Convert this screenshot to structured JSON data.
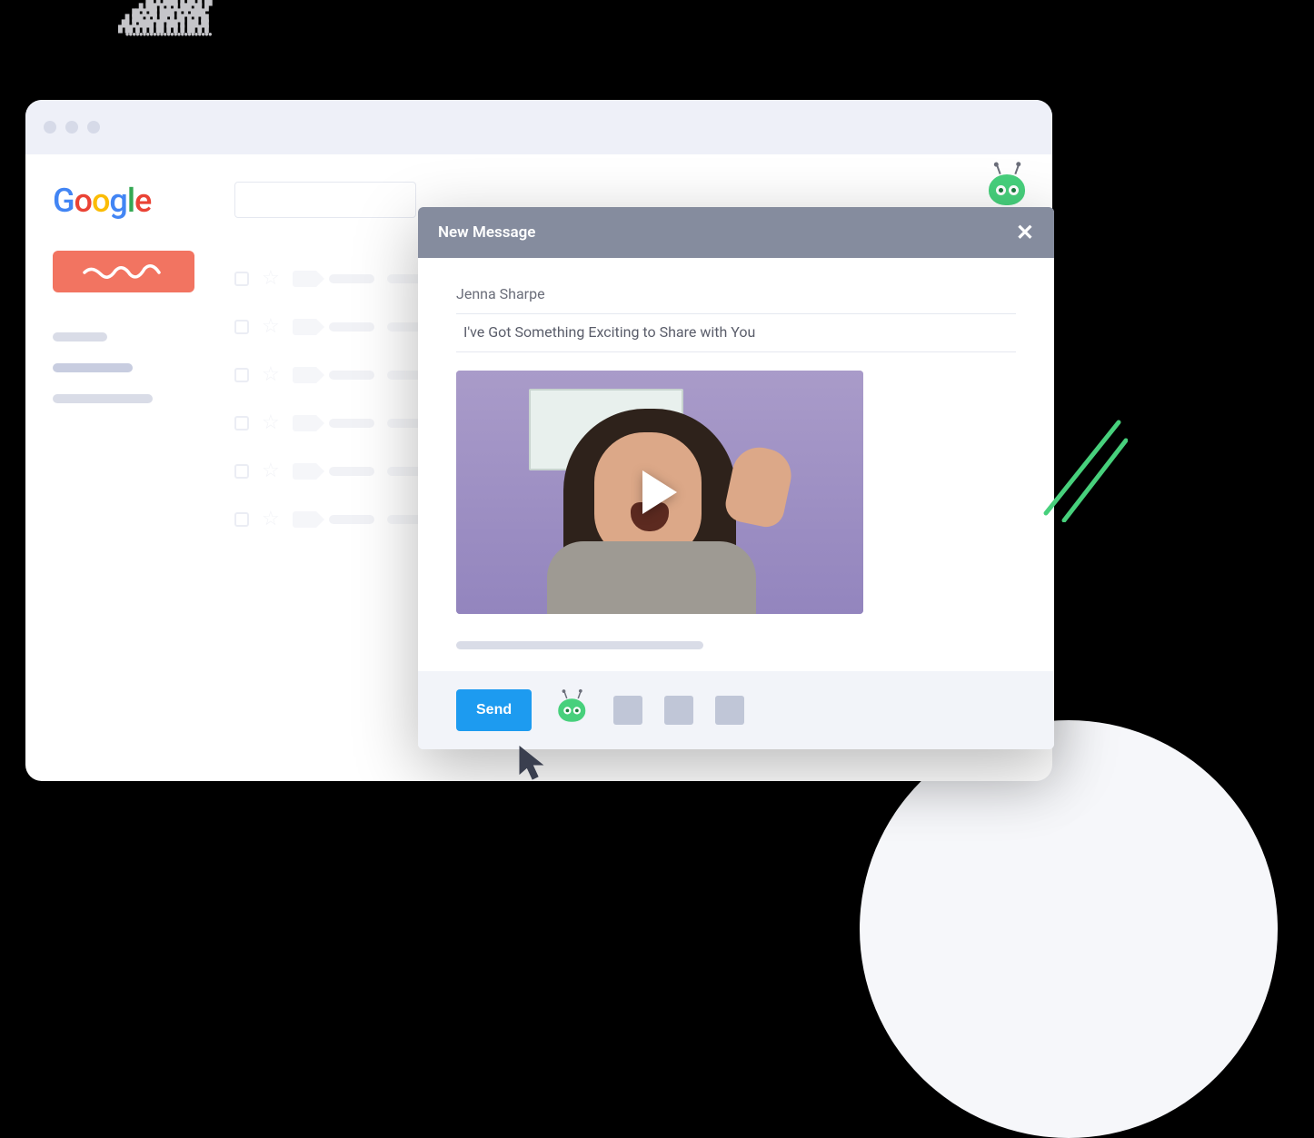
{
  "compose": {
    "header": "New Message",
    "recipient": "Jenna Sharpe",
    "subject": "I've Got Something Exciting to Share with You",
    "send_label": "Send"
  }
}
